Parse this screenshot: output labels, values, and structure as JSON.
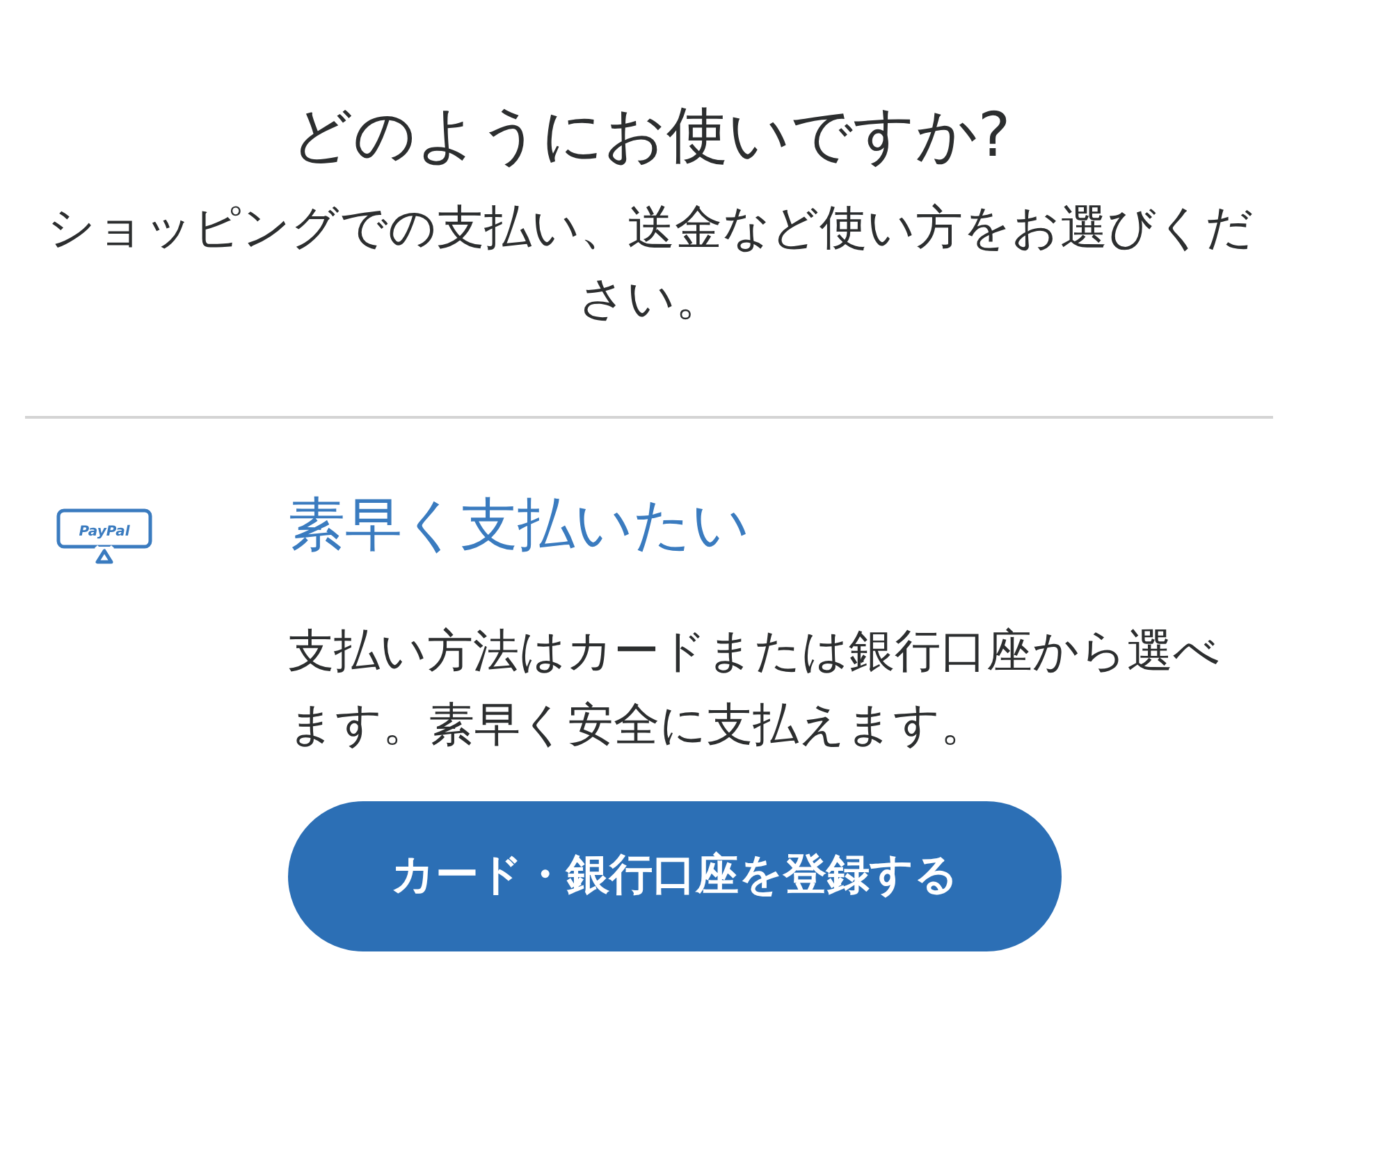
{
  "header": {
    "title": "どのようにお使いですか?",
    "subtitle": "ショッピングでの支払い、送金など使い方をお選びください。"
  },
  "options": [
    {
      "icon_label": "PayPal",
      "title": "素早く支払いたい",
      "description": "支払い方法はカードまたは銀行口座から選べます。素早く安全に支払えます。",
      "button": "カード・銀行口座を登録する"
    }
  ]
}
